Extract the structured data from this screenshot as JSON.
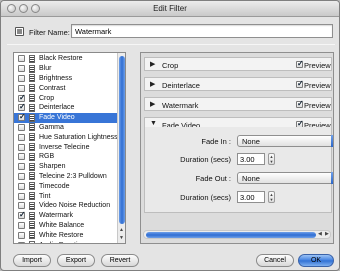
{
  "window": {
    "title": "Edit Filter"
  },
  "filter_name": {
    "label": "Filter Name:",
    "value": "Watermark"
  },
  "filters_list": [
    {
      "label": "Black Restore",
      "checked": false,
      "selected": false
    },
    {
      "label": "Blur",
      "checked": false,
      "selected": false
    },
    {
      "label": "Brightness",
      "checked": false,
      "selected": false
    },
    {
      "label": "Contrast",
      "checked": false,
      "selected": false
    },
    {
      "label": "Crop",
      "checked": true,
      "selected": false
    },
    {
      "label": "Deinterlace",
      "checked": true,
      "selected": false
    },
    {
      "label": "Fade Video",
      "checked": true,
      "selected": true
    },
    {
      "label": "Gamma",
      "checked": false,
      "selected": false
    },
    {
      "label": "Hue Saturation Lightness",
      "checked": false,
      "selected": false
    },
    {
      "label": "Inverse Telecine",
      "checked": false,
      "selected": false
    },
    {
      "label": "RGB",
      "checked": false,
      "selected": false
    },
    {
      "label": "Sharpen",
      "checked": false,
      "selected": false
    },
    {
      "label": "Telecine 2:3 Pulldown",
      "checked": false,
      "selected": false
    },
    {
      "label": "Timecode",
      "checked": false,
      "selected": false
    },
    {
      "label": "Tint",
      "checked": false,
      "selected": false
    },
    {
      "label": "Video Noise Reduction",
      "checked": false,
      "selected": false
    },
    {
      "label": "Watermark",
      "checked": true,
      "selected": false
    },
    {
      "label": "White Balance",
      "checked": false,
      "selected": false
    },
    {
      "label": "White Restore",
      "checked": false,
      "selected": false
    },
    {
      "label": "Audio Duration",
      "checked": false,
      "selected": false
    }
  ],
  "active_filters": [
    {
      "name": "Crop",
      "expanded": false,
      "preview_checked": true
    },
    {
      "name": "Deinterlace",
      "expanded": false,
      "preview_checked": true
    },
    {
      "name": "Watermark",
      "expanded": false,
      "preview_checked": true
    },
    {
      "name": "Fade Video",
      "expanded": true,
      "preview_checked": true
    }
  ],
  "preview_label": "Preview",
  "fade_settings": {
    "fade_in_label": "Fade In :",
    "fade_in_value": "None",
    "duration_in_label": "Duration (secs)",
    "duration_in_value": "3.00",
    "fade_out_label": "Fade Out :",
    "fade_out_value": "None",
    "duration_out_label": "Duration (secs)",
    "duration_out_value": "3.00"
  },
  "buttons": {
    "import": "Import",
    "export": "Export",
    "revert": "Revert",
    "cancel": "Cancel",
    "ok": "OK"
  },
  "colors": {
    "selection": "#3875d7",
    "accent": "#2f6ed3"
  }
}
